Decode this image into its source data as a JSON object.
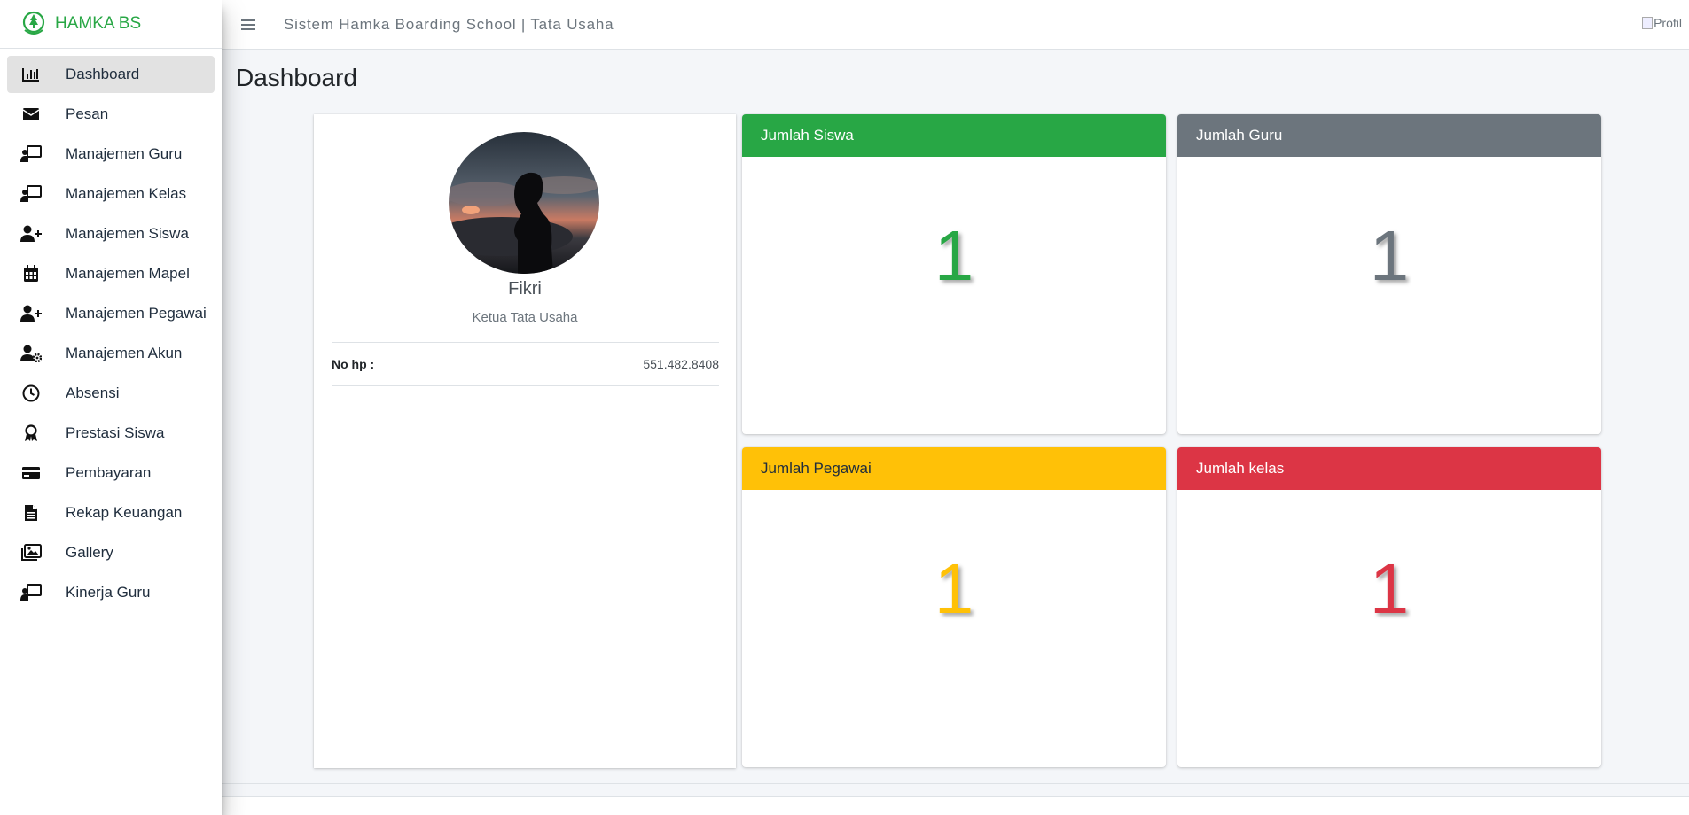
{
  "brand": {
    "name": "HAMKA BS",
    "color": "#28a745"
  },
  "sidebar": {
    "items": [
      {
        "label": "Dashboard",
        "icon": "chart-bar-icon",
        "active": true
      },
      {
        "label": "Pesan",
        "icon": "envelope-icon"
      },
      {
        "label": "Manajemen Guru",
        "icon": "chalkboard-teacher-icon"
      },
      {
        "label": "Manajemen Kelas",
        "icon": "chalkboard-teacher-icon"
      },
      {
        "label": "Manajemen Siswa",
        "icon": "user-plus-icon"
      },
      {
        "label": "Manajemen Mapel",
        "icon": "calendar-icon"
      },
      {
        "label": "Manajemen Pegawai",
        "icon": "user-plus-icon"
      },
      {
        "label": "Manajemen Akun",
        "icon": "user-cog-icon"
      },
      {
        "label": "Absensi",
        "icon": "clock-icon"
      },
      {
        "label": "Prestasi Siswa",
        "icon": "award-icon"
      },
      {
        "label": "Pembayaran",
        "icon": "credit-card-icon"
      },
      {
        "label": "Rekap Keuangan",
        "icon": "file-alt-icon"
      },
      {
        "label": "Gallery",
        "icon": "images-icon"
      },
      {
        "label": "Kinerja Guru",
        "icon": "chalkboard-teacher-icon"
      }
    ]
  },
  "topbar": {
    "title": "Sistem Hamka Boarding School | Tata Usaha",
    "profile_alt": "Profil"
  },
  "page": {
    "title": "Dashboard"
  },
  "profile": {
    "name": "Fikri",
    "role": "Ketua Tata Usaha",
    "phone_label": "No hp :",
    "phone_value": "551.482.8408"
  },
  "stats": [
    {
      "title": "Jumlah Siswa",
      "value": "1",
      "color": "#28a745",
      "text_color": "#ffffff"
    },
    {
      "title": "Jumlah Guru",
      "value": "1",
      "color": "#6c757d",
      "text_color": "#ffffff"
    },
    {
      "title": "Jumlah Pegawai",
      "value": "1",
      "color": "#ffc107",
      "text_color": "#1f2d3d"
    },
    {
      "title": "Jumlah kelas",
      "value": "1",
      "color": "#dc3545",
      "text_color": "#ffffff"
    }
  ]
}
